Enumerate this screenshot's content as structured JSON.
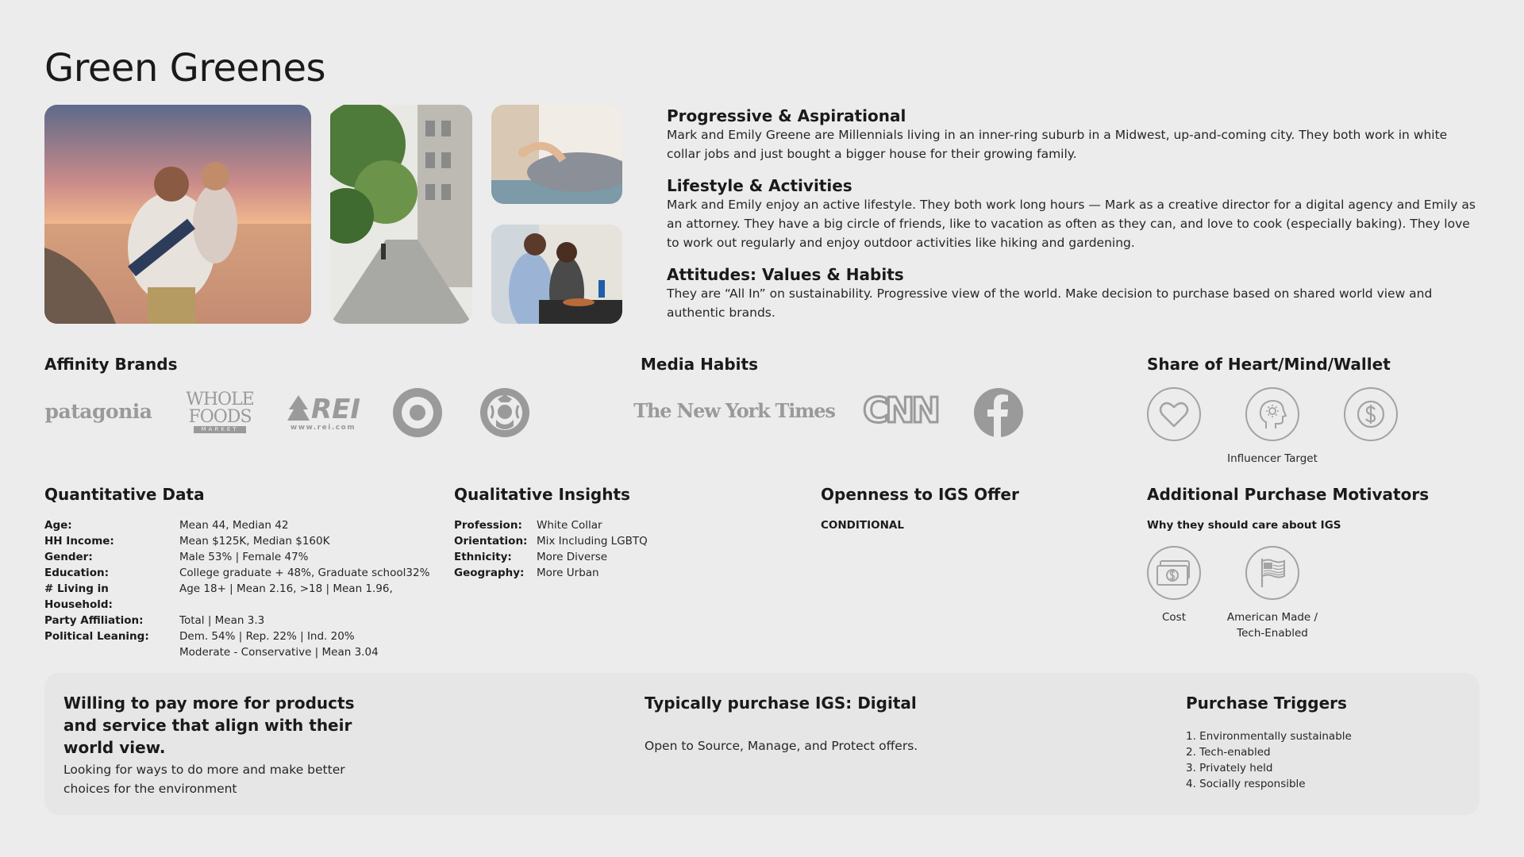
{
  "title": "Green Greenes",
  "profile": [
    {
      "heading": "Progressive & Aspirational",
      "text": "Mark and Emily Greene are Millennials living in an inner-ring suburb in a Midwest, up-and-coming city. They both work in white collar jobs and just bought a bigger house for their growing family."
    },
    {
      "heading": "Lifestyle & Activities",
      "text": "Mark and Emily enjoy an active lifestyle. They both work long hours — Mark as a creative director for a digital agency and Emily as an attorney. They have a big circle of friends, like to vacation as often as they can, and love to cook (especially baking). They love to work out regularly and enjoy outdoor activities like hiking and gardening."
    },
    {
      "heading": "Attitudes: Values & Habits",
      "text": "They are “All In” on sustainability. Progressive view of the world. Make decision to purchase based on shared world view and authentic brands."
    }
  ],
  "affinity": {
    "heading": "Affinity Brands",
    "brands": [
      {
        "icon": "patagonia-logo",
        "label": "patagonia"
      },
      {
        "icon": "whole-foods-logo",
        "label1": "WHOLE",
        "label2": "FOODS",
        "label3": "MARKET"
      },
      {
        "icon": "rei-logo",
        "label": "REI",
        "sub": "www.rei.com"
      },
      {
        "icon": "target-logo"
      },
      {
        "icon": "starbucks-logo"
      }
    ]
  },
  "media": {
    "heading": "Media Habits",
    "outlets": [
      {
        "icon": "nyt-logo",
        "label": "The New York Times"
      },
      {
        "icon": "cnn-logo",
        "label": "CNN"
      },
      {
        "icon": "facebook-logo"
      }
    ]
  },
  "share": {
    "heading": "Share of Heart/Mind/Wallet",
    "items": [
      {
        "icon": "heart-icon",
        "caption": ""
      },
      {
        "icon": "mind-icon",
        "caption": "Influencer Target"
      },
      {
        "icon": "dollar-icon",
        "caption": ""
      }
    ]
  },
  "quant": {
    "heading": "Quantitative Data",
    "rows": [
      {
        "k": "Age:",
        "v": "Mean 44, Median 42"
      },
      {
        "k": "HH Income:",
        "v": "Mean $125K, Median $160K"
      },
      {
        "k": "Gender:",
        "v": "Male 53% | Female 47%"
      },
      {
        "k": "Education:",
        "v": "College graduate + 48%, Graduate school32%"
      },
      {
        "k": "# Living in Household:",
        "v": "Age 18+ | Mean 2.16, >18 | Mean 1.96,"
      },
      {
        "k": "Party Affiliation:",
        "v": "Total | Mean 3.3"
      },
      {
        "k": "Political Leaning:",
        "v": "Dem. 54% | Rep. 22% | Ind. 20%"
      },
      {
        "k": "",
        "v": "Moderate - Conservative | Mean 3.04"
      }
    ]
  },
  "qual": {
    "heading": "Qualitative Insights",
    "rows": [
      {
        "k": "Profession:",
        "v": "White Collar"
      },
      {
        "k": "Orientation:",
        "v": "Mix Including LGBTQ"
      },
      {
        "k": "Ethnicity:",
        "v": "More Diverse"
      },
      {
        "k": "Geography:",
        "v": "More Urban"
      }
    ]
  },
  "openness": {
    "heading": "Openness to IGS Offer",
    "value": "CONDITIONAL"
  },
  "motivators": {
    "heading": "Additional Purchase Motivators",
    "sub": "Why they should care about IGS",
    "items": [
      {
        "icon": "cash-icon",
        "caption": "Cost"
      },
      {
        "icon": "flag-icon",
        "caption": "American Made / Tech-Enabled"
      }
    ]
  },
  "panel": {
    "left_heading": "Willing to pay more for products and service that align with their world view.",
    "left_text": "Looking for ways to do more and make better choices for the environment",
    "mid_heading": "Typically purchase IGS: Digital",
    "mid_text": "Open to Source, Manage, and Protect offers.",
    "right_heading": "Purchase Triggers",
    "triggers": [
      "1. Environmentally sustainable",
      "2. Tech-enabled",
      "3. Privately held",
      "4. Socially responsible"
    ]
  },
  "colors": {
    "logo_gray": "#9a9a9a",
    "background": "#ececec",
    "panel": "#e6e6e6"
  }
}
